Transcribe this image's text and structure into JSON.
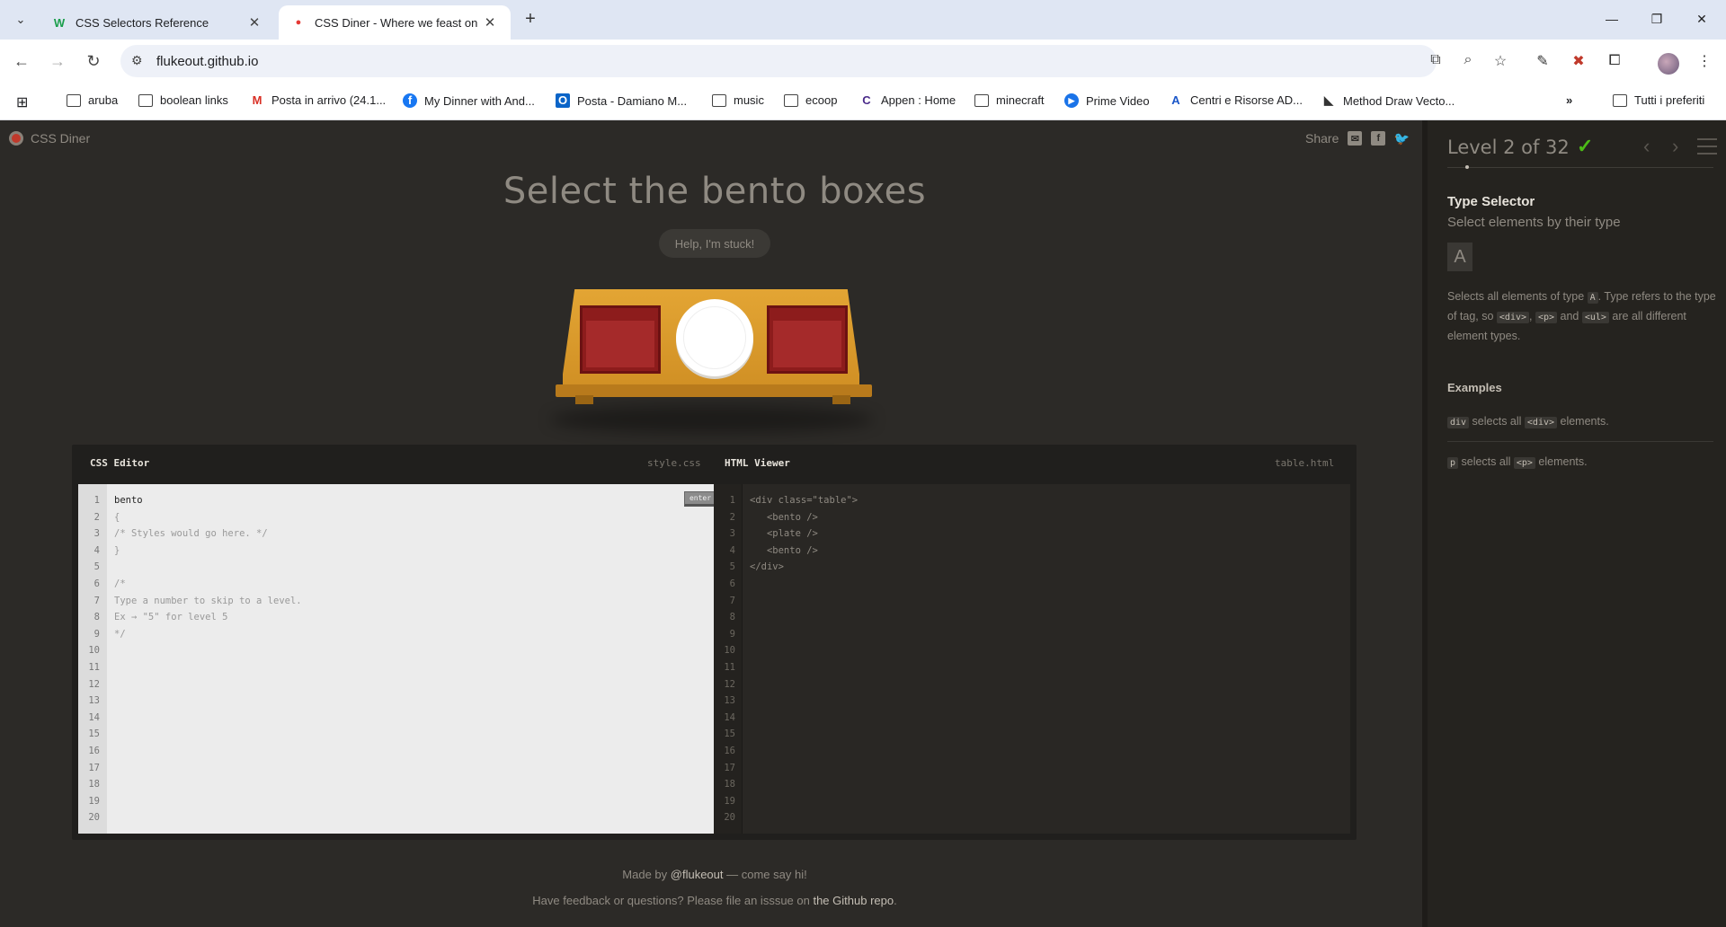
{
  "browser": {
    "tabs": [
      {
        "title": "CSS Selectors Reference",
        "favicon": "W"
      },
      {
        "title": "CSS Diner - Where we feast on",
        "favicon": "●"
      }
    ],
    "url": "flukeout.github.io",
    "bookmarks": [
      {
        "label": "aruba",
        "icon": "folder-icon"
      },
      {
        "label": "boolean links",
        "icon": "folder-icon"
      },
      {
        "label": "Posta in arrivo (24.1...",
        "icon": "gmail-icon"
      },
      {
        "label": "My Dinner with And...",
        "icon": "facebook-icon"
      },
      {
        "label": "Posta - Damiano M...",
        "icon": "outlook-icon"
      },
      {
        "label": "music",
        "icon": "folder-icon"
      },
      {
        "label": "ecoop",
        "icon": "folder-icon"
      },
      {
        "label": "Appen : Home",
        "icon": "appen-icon"
      },
      {
        "label": "minecraft",
        "icon": "folder-icon"
      },
      {
        "label": "Prime Video",
        "icon": "prime-icon"
      },
      {
        "label": "Centri e Risorse AD...",
        "icon": "adobe-icon"
      },
      {
        "label": "Method Draw Vecto...",
        "icon": "method-draw-icon"
      }
    ],
    "all_bookmarks": "Tutti i preferiti"
  },
  "app": {
    "brand": "CSS Diner",
    "share": "Share",
    "instruction": "Select the bento boxes",
    "help": "Help, I'm stuck!",
    "css_editor": {
      "title": "CSS Editor",
      "file": "style.css",
      "enter": "enter",
      "lines": [
        "bento",
        "{",
        "/* Styles would go here. */",
        "}",
        "",
        "/*",
        "Type a number to skip to a level.",
        "Ex → \"5\" for level 5",
        "*/"
      ],
      "line_count": 20
    },
    "html_viewer": {
      "title": "HTML Viewer",
      "file": "table.html",
      "lines": [
        "<div class=\"table\">",
        "   <bento />",
        "   <plate />",
        "   <bento />",
        "</div>"
      ],
      "line_count": 20
    },
    "footer": {
      "made_by_prefix": "Made by ",
      "made_by_link": "@flukeout",
      "made_by_suffix": " — come say hi!",
      "feedback_prefix": "Have feedback or questions? Please file an isssue on ",
      "feedback_link": "the Github repo",
      "feedback_suffix": "."
    }
  },
  "sidebar": {
    "level": "Level 2 of 32",
    "completed": true,
    "selector_name": "Type Selector",
    "selector_subtitle": "Select elements by their type",
    "syntax": "A",
    "description": {
      "p1": "Selects all elements of type ",
      "tag_a": "A",
      "p2": ". Type refers to the type of tag, so ",
      "tag_div": "<div>",
      "p3": ", ",
      "tag_p": "<p>",
      "p4": " and ",
      "tag_ul": "<ul>",
      "p5": " are all different element types."
    },
    "examples_title": "Examples",
    "examples": [
      {
        "code": "div",
        "text_a": " selects all ",
        "tag": "<div>",
        "text_b": " elements."
      },
      {
        "code": "p",
        "text_a": " selects all ",
        "tag": "<p>",
        "text_b": " elements."
      }
    ]
  },
  "colors": {
    "page_bg": "#2c2a27",
    "bento": "#a52a2a",
    "table": "#e3a534",
    "check": "#4cbb17"
  }
}
